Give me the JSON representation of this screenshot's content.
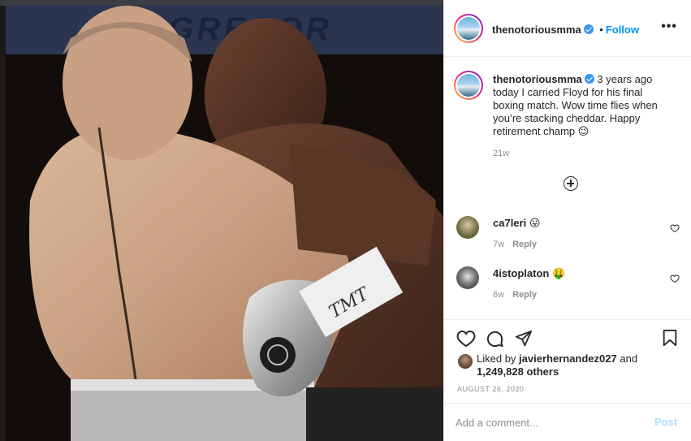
{
  "post": {
    "author": "thenotoriousmma",
    "follow_label": "Follow",
    "more_icon": "more-options-icon",
    "photo_banner": "MCGREGOR",
    "photo_glove_text": "TMT"
  },
  "caption": {
    "username": "thenotoriousmma",
    "posted_ago": "3 years ago",
    "text": "today I carried Floyd for his final boxing match. Wow time flies when you’re stacking cheddar. Happy retirement champ 😉",
    "age": "21w"
  },
  "comments": [
    {
      "username": "ca7leri",
      "emoji": "😛",
      "age": "7w",
      "reply_label": "Reply"
    },
    {
      "username": "4istoplaton",
      "emoji": "🤑",
      "age": "6w",
      "reply_label": "Reply"
    }
  ],
  "likes": {
    "prefix": "Liked by",
    "user": "javierhernandez027",
    "and_word": "and",
    "others": "1,249,828 others"
  },
  "date": "AUGUST 26, 2020",
  "composer": {
    "placeholder": "Add a comment...",
    "post_label": "Post"
  },
  "colors": {
    "link_blue": "#0095f6",
    "verified_blue": "#3897f0",
    "post_disabled": "#b2dffc",
    "muted_text": "#8e8e8e"
  }
}
